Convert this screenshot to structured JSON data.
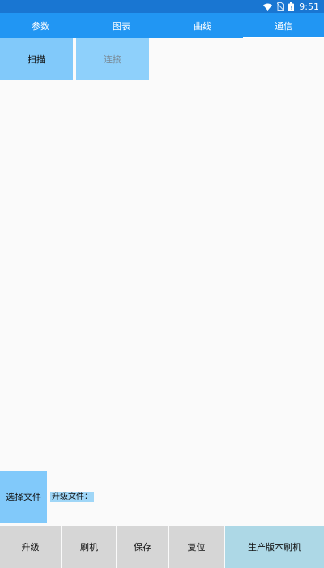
{
  "status_bar": {
    "time": "9:51",
    "icons": [
      "wifi-icon",
      "no-sim-icon",
      "battery-icon"
    ]
  },
  "tabs": [
    {
      "label": "参数",
      "active": false
    },
    {
      "label": "图表",
      "active": false
    },
    {
      "label": "曲线",
      "active": false
    },
    {
      "label": "通信",
      "active": true
    }
  ],
  "actions": {
    "scan_label": "扫描",
    "connect_label": "连接"
  },
  "file": {
    "select_label": "选择文件",
    "upgrade_file_label": "升级文件："
  },
  "bottom_buttons": [
    {
      "label": "升级"
    },
    {
      "label": "刷机"
    },
    {
      "label": "保存"
    },
    {
      "label": "复位"
    },
    {
      "label": "生产版本刷机"
    }
  ],
  "colors": {
    "status_bar": "#1976d2",
    "tab_bar": "#2196f3",
    "button_blue": "#81c9fa",
    "button_gray": "#d6d6d6",
    "button_light_blue": "#add8e6",
    "background": "#fafafa"
  }
}
